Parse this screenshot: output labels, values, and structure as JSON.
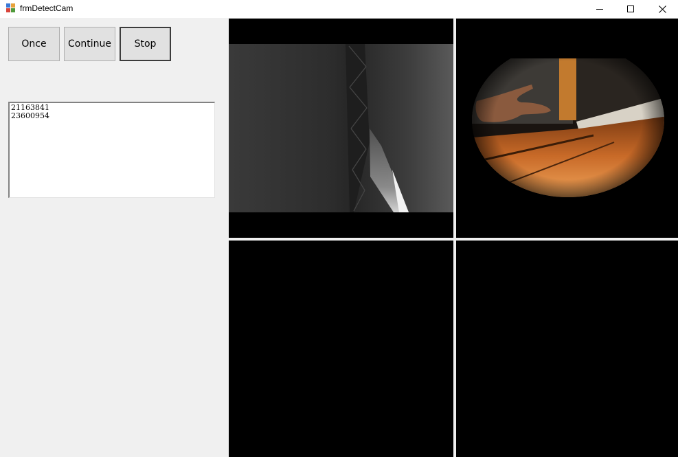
{
  "window": {
    "title": "frmDetectCam",
    "icon": "app-form-icon",
    "controls": [
      "minimize-icon",
      "maximize-icon",
      "close-icon"
    ]
  },
  "toolbar": {
    "once_label": "Once",
    "continue_label": "Continue",
    "stop_label": "Stop"
  },
  "device_list": {
    "lines": [
      "21163841",
      "23600954"
    ]
  },
  "cameras": [
    {
      "id": "camera-1",
      "state": "live",
      "content": "monochrome view of metal truss structure"
    },
    {
      "id": "camera-2",
      "state": "live",
      "content": "color fisheye view of hand over wooden floor"
    },
    {
      "id": "camera-3",
      "state": "empty"
    },
    {
      "id": "camera-4",
      "state": "empty"
    }
  ],
  "colors": {
    "form_background": "#f0f0f0",
    "button_face": "#e1e1e1",
    "camera_background": "#000000"
  }
}
